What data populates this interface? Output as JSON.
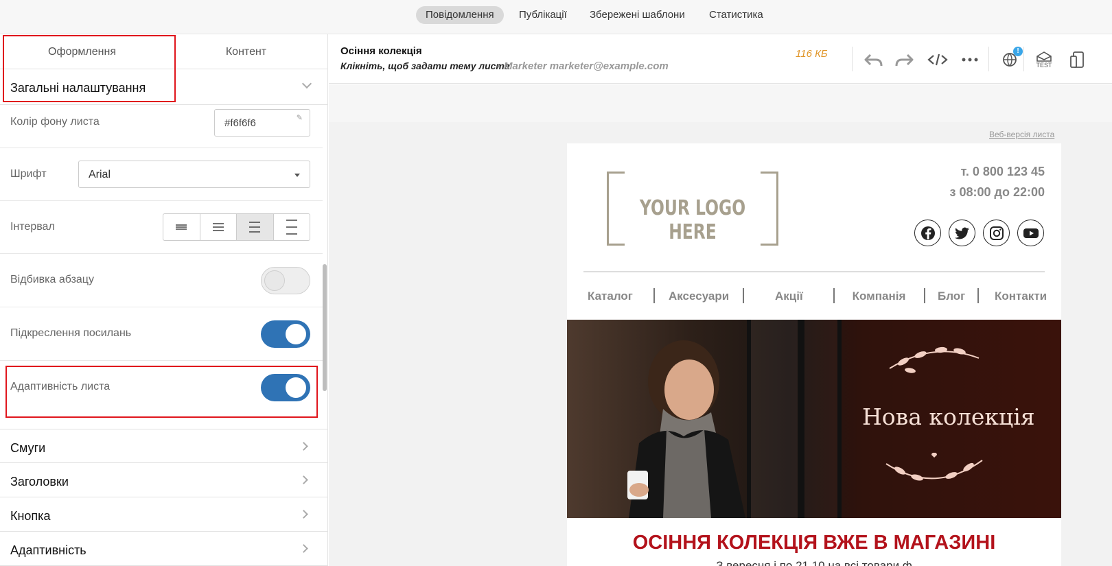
{
  "topnav": {
    "tabs": [
      {
        "label": "Повідомлення",
        "active": true
      },
      {
        "label": "Публікації",
        "active": false
      },
      {
        "label": "Збережені шаблони",
        "active": false
      },
      {
        "label": "Статистика",
        "active": false
      }
    ]
  },
  "left_panel": {
    "tabs": [
      {
        "label": "Оформлення",
        "active": true
      },
      {
        "label": "Контент",
        "active": false
      }
    ],
    "section_title": "Загальні налаштування",
    "settings": {
      "bg_color_label": "Колір фону листа",
      "bg_color_value": "#f6f6f6",
      "font_label": "Шрифт",
      "font_value": "Arial",
      "interval_label": "Інтервал",
      "interval_selected_index": 2,
      "paragraph_label": "Відбивка абзацу",
      "paragraph_on": false,
      "underline_label": "Підкреслення посилань",
      "underline_on": true,
      "adaptive_label": "Адаптивність листа",
      "adaptive_on": true
    },
    "accordion": [
      "Смуги",
      "Заголовки",
      "Кнопка",
      "Адаптивність"
    ]
  },
  "editor": {
    "subject_name": "Осіння колекція",
    "subject_hint": "Клікніть, щоб задати тему листа",
    "sender": "Marketer marketer@example.com",
    "size": "116 КБ",
    "badge": "!",
    "toolbar_icons": [
      "undo-icon",
      "redo-icon",
      "code-icon",
      "more-icon",
      "globe-icon",
      "test-icon",
      "device-preview-icon"
    ],
    "test_label": "TEST"
  },
  "email": {
    "web_version": "Веб-версія листа",
    "logo_text": "YOUR LOGO HERE",
    "phone": "т. 0 800 123 45",
    "hours": "з 08:00 до 22:00",
    "socials": [
      "facebook-icon",
      "twitter-icon",
      "instagram-icon",
      "youtube-icon"
    ],
    "nav": [
      "Каталог",
      "Аксесуари",
      "Акції",
      "Компанія",
      "Блог",
      "Контакти"
    ],
    "hero_title": "Нова колекція",
    "headline": "ОСІННЯ КОЛЕКЦІЯ ВЖЕ В МАГАЗИНІ",
    "subline": "З вересня і по 21.10 на всі товари ф"
  },
  "colors": {
    "accent": "#2f73b5",
    "highlight": "#e0151c",
    "size_text": "#e0962a",
    "headline": "#b3121b"
  }
}
